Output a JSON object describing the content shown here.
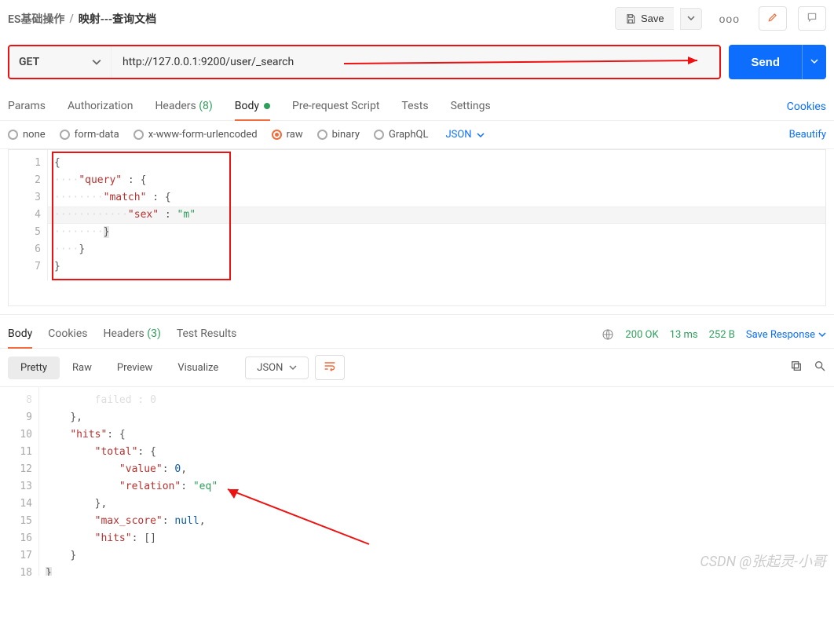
{
  "breadcrumb": {
    "root": "ES基础操作",
    "sep": "/",
    "current": "映射---查询文档"
  },
  "toolbar": {
    "save": "Save",
    "ellipsis": "ooo"
  },
  "request": {
    "method": "GET",
    "url": "http://127.0.0.1:9200/user/_search",
    "send": "Send"
  },
  "tabs": {
    "params": "Params",
    "auth": "Authorization",
    "headers": "Headers",
    "headers_count": "(8)",
    "body": "Body",
    "prescript": "Pre-request Script",
    "tests": "Tests",
    "settings": "Settings",
    "cookies": "Cookies"
  },
  "body_types": {
    "none": "none",
    "form_data": "form-data",
    "urlenc": "x-www-form-urlencoded",
    "raw": "raw",
    "binary": "binary",
    "graphql": "GraphQL",
    "json": "JSON",
    "beautify": "Beautify"
  },
  "req_editor": {
    "lines": [
      "1",
      "2",
      "3",
      "4",
      "5",
      "6",
      "7"
    ],
    "l1": "{",
    "l2_key": "\"query\"",
    "l2_after": " : {",
    "l3_key": "\"match\"",
    "l3_after": " : {",
    "l4_key": "\"sex\"",
    "l4_val": "\"m\"",
    "l5": "}",
    "l6": "}",
    "l7": "}"
  },
  "response": {
    "tabs": {
      "body": "Body",
      "cookies": "Cookies",
      "headers": "Headers",
      "headers_count": "(3)",
      "tests": "Test Results"
    },
    "status": "200 OK",
    "time": "13 ms",
    "size": "252 B",
    "save": "Save Response",
    "view": {
      "pretty": "Pretty",
      "raw": "Raw",
      "preview": "Preview",
      "visualize": "Visualize",
      "json": "JSON"
    }
  },
  "resp_editor": {
    "lines": [
      "8",
      "9",
      "10",
      "11",
      "12",
      "13",
      "14",
      "15",
      "16",
      "17",
      "18"
    ],
    "l8_key": "failed",
    "l8_val": "0",
    "l9": "},",
    "l10_key": "\"hits\"",
    "l10_after": ": {",
    "l11_key": "\"total\"",
    "l11_after": ": {",
    "l12_key": "\"value\"",
    "l12_val": "0",
    "l12_comma": ",",
    "l13_key": "\"relation\"",
    "l13_val": "\"eq\"",
    "l14": "},",
    "l15_key": "\"max_score\"",
    "l15_val": "null",
    "l15_comma": ",",
    "l16_key": "\"hits\"",
    "l16_val": "[]",
    "l17": "}",
    "l18": "}"
  },
  "watermark": "CSDN @张起灵-小哥"
}
